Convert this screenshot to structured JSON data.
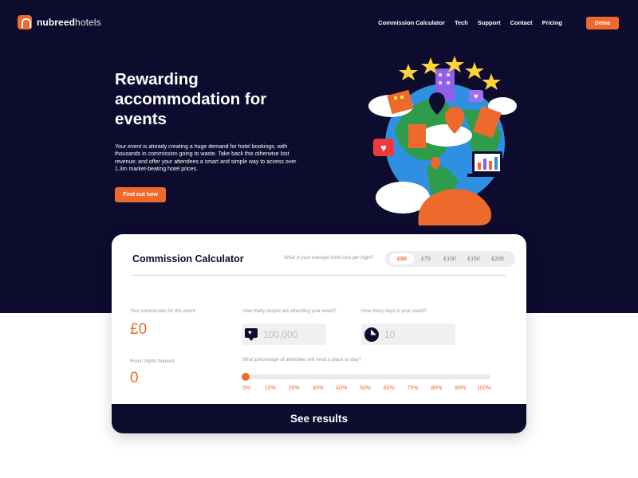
{
  "header": {
    "logo_bold": "nubreed",
    "logo_light": "hotels",
    "nav": [
      "Commission Calculator",
      "Tech",
      "Support",
      "Contact",
      "Pricing"
    ],
    "demo_label": "Demo"
  },
  "hero": {
    "headline": "Rewarding accommodation for events",
    "body": "Your event is already creating a huge demand for hotel bookings, with thousands in commission going to waste. Take back this otherwise lost revenue; and offer your attendees a smart and simple way to access over 1.3m market-beating hotel prices.",
    "cta_label": "Find out how"
  },
  "calculator": {
    "title": "Commission Calculator",
    "cost_question": "What is your average hotel cost per night?",
    "cost_options": [
      "£50",
      "£75",
      "£100",
      "£150",
      "£200"
    ],
    "cost_selected": "£50",
    "commission_label": "Your commission for this event:",
    "commission_value": "£0",
    "room_nights_label": "Room nights booked:",
    "room_nights_value": "0",
    "attendees_label": "How many people are attending your event?",
    "attendees_placeholder": "100,000",
    "days_label": "How many days is your event?",
    "days_placeholder": "10",
    "percentage_label": "What percentage of attendees will need a place to stay?",
    "percentage_ticks": [
      "0%",
      "10%",
      "20%",
      "30%",
      "40%",
      "50%",
      "60%",
      "70%",
      "80%",
      "90%",
      "100%"
    ],
    "percentage_value": 0,
    "see_results_label": "See results"
  },
  "colors": {
    "navy": "#0d0b2e",
    "accent": "#ee6a2c"
  },
  "icons": [
    "logo-icon",
    "speech-heart-icon",
    "clock-icon",
    "globe-illustration"
  ]
}
